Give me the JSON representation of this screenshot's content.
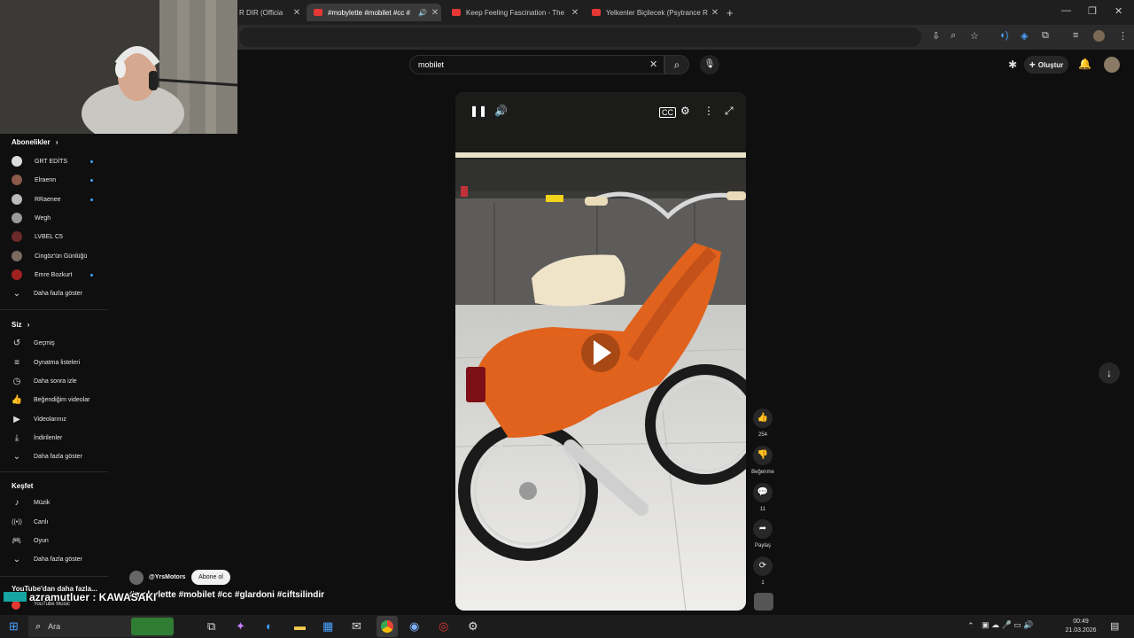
{
  "browser": {
    "tabs": [
      {
        "title": "R DIR (Officia"
      },
      {
        "title": "#mobylette #mobilet #cc #",
        "active": true
      },
      {
        "title": "Keep Feeling Fascination - The"
      },
      {
        "title": "Yelkenler Biçilecek (Psytrance R"
      }
    ],
    "new_tab": "+",
    "minimize": "—",
    "restore": "❐",
    "close": "✕"
  },
  "youtube": {
    "search_value": "mobilet",
    "create_label": "Oluştur"
  },
  "sidebar": {
    "subscriptions_title": "Abonelikler",
    "subscriptions": [
      {
        "label": "GRT EDİTS",
        "new": true,
        "color": "#dddddd"
      },
      {
        "label": "Elraenn",
        "new": true,
        "color": "#8a5a4a"
      },
      {
        "label": "RRaenee",
        "new": true,
        "color": "#bbbbbb"
      },
      {
        "label": "Wegh",
        "new": false,
        "color": "#9a9a9a"
      },
      {
        "label": "LVBEL C5",
        "new": false,
        "color": "#6a2a2a"
      },
      {
        "label": "Cingöz'ün Günlüğü",
        "new": false,
        "color": "#7a6a60"
      },
      {
        "label": "Emre Bozkurt",
        "new": true,
        "color": "#a02020"
      }
    ],
    "show_more": "Daha fazla göster",
    "you_title": "Siz",
    "you_items": [
      {
        "icon": "history-icon",
        "glyph": "↺",
        "label": "Geçmiş"
      },
      {
        "icon": "playlist-icon",
        "glyph": "≡",
        "label": "Oynatma listeleri"
      },
      {
        "icon": "clock-icon",
        "glyph": "◷",
        "label": "Daha sonra izle"
      },
      {
        "icon": "thumbs-up-icon",
        "glyph": "👍",
        "label": "Beğendiğim videolar"
      },
      {
        "icon": "video-icon",
        "glyph": "▶",
        "label": "Videolarınız"
      },
      {
        "icon": "download-icon",
        "glyph": "⤓",
        "label": "İndirilenler"
      }
    ],
    "explore_title": "Keşfet",
    "explore_items": [
      {
        "icon": "music-icon",
        "glyph": "♪",
        "label": "Müzik"
      },
      {
        "icon": "live-icon",
        "glyph": "((•))",
        "label": "Canlı"
      },
      {
        "icon": "game-icon",
        "glyph": "🎮",
        "label": "Oyun"
      }
    ],
    "more_from_youtube": "YouTube'dan daha fazla...",
    "youtube_music": "YouTube Music"
  },
  "video": {
    "channel": "@YrsMotors",
    "subscribe": "Abone ol",
    "title": "#mobylette #mobilet #cc #glardoni #ciftsilindir",
    "likes": "254",
    "dislike_label": "Beğenme",
    "comments": "11",
    "share_label": "Paylaş",
    "remix_count": "1"
  },
  "overlay": {
    "chat_line": "azramutluer : KAWASAKI"
  },
  "taskbar": {
    "search_placeholder": "Ara",
    "time": "00:49",
    "date": "21.03.2026"
  }
}
